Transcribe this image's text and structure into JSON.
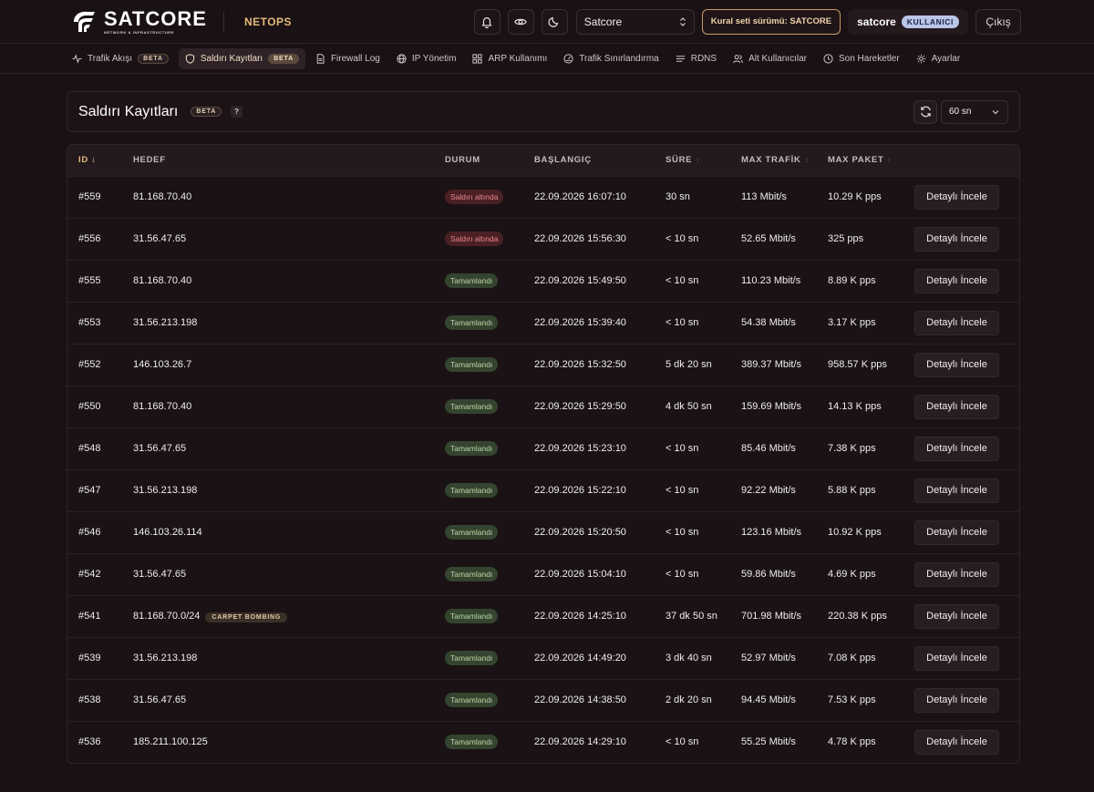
{
  "brand": {
    "name": "SATCORE",
    "tagline": "NETWORK & INFRASTRUCTURE",
    "product": "NETOPS"
  },
  "header": {
    "tenant_select": "Satcore",
    "ruleset": "Kural seti sürümü: SATCORE",
    "user": "satcore",
    "role": "KULLANICI",
    "logout": "Çıkış"
  },
  "nav": [
    {
      "label": "Trafik Akışı",
      "badge": "BETA",
      "icon": "activity-icon",
      "active": false
    },
    {
      "label": "Saldırı Kayıtları",
      "badge": "BETA",
      "icon": "shield-icon",
      "active": true
    },
    {
      "label": "Firewall Log",
      "badge": "",
      "icon": "document-icon",
      "active": false
    },
    {
      "label": "IP Yönetim",
      "badge": "",
      "icon": "globe-icon",
      "active": false
    },
    {
      "label": "ARP Kullanımı",
      "badge": "",
      "icon": "grid-icon",
      "active": false
    },
    {
      "label": "Trafik Sınırlandırma",
      "badge": "",
      "icon": "gauge-icon",
      "active": false
    },
    {
      "label": "RDNS",
      "badge": "",
      "icon": "list-icon",
      "active": false
    },
    {
      "label": "Alt Kullanıcılar",
      "badge": "",
      "icon": "users-icon",
      "active": false
    },
    {
      "label": "Son Hareketler",
      "badge": "",
      "icon": "clock-icon",
      "active": false
    },
    {
      "label": "Ayarlar",
      "badge": "",
      "icon": "gear-icon",
      "active": false
    }
  ],
  "panel": {
    "title": "Saldırı Kayıtları",
    "badge": "BETA",
    "help": "?",
    "interval": "60 sn"
  },
  "table": {
    "headers": {
      "id": "ID",
      "target": "HEDEF",
      "status": "DURUM",
      "start": "BAŞLANGIÇ",
      "duration": "SÜRE",
      "max_traffic": "MAX TRAFİK",
      "max_packet": "MAX PAKET"
    },
    "action_label": "Detaylı İncele",
    "rows": [
      {
        "id": "#559",
        "target": "81.168.70.40",
        "tag": "",
        "status": "Saldırı altında",
        "status_type": "attack",
        "start": "22.09.2026 16:07:10",
        "duration": "30 sn",
        "max_traffic": "113 Mbit/s",
        "max_packet": "10.29 K pps"
      },
      {
        "id": "#556",
        "target": "31.56.47.65",
        "tag": "",
        "status": "Saldırı altında",
        "status_type": "attack",
        "start": "22.09.2026 15:56:30",
        "duration": "< 10 sn",
        "max_traffic": "52.65 Mbit/s",
        "max_packet": "325 pps"
      },
      {
        "id": "#555",
        "target": "81.168.70.40",
        "tag": "",
        "status": "Tamamlandı",
        "status_type": "done",
        "start": "22.09.2026 15:49:50",
        "duration": "< 10 sn",
        "max_traffic": "110.23 Mbit/s",
        "max_packet": "8.89 K pps"
      },
      {
        "id": "#553",
        "target": "31.56.213.198",
        "tag": "",
        "status": "Tamamlandı",
        "status_type": "done",
        "start": "22.09.2026 15:39:40",
        "duration": "< 10 sn",
        "max_traffic": "54.38 Mbit/s",
        "max_packet": "3.17 K pps"
      },
      {
        "id": "#552",
        "target": "146.103.26.7",
        "tag": "",
        "status": "Tamamlandı",
        "status_type": "done",
        "start": "22.09.2026 15:32:50",
        "duration": "5 dk 20 sn",
        "max_traffic": "389.37 Mbit/s",
        "max_packet": "958.57 K pps"
      },
      {
        "id": "#550",
        "target": "81.168.70.40",
        "tag": "",
        "status": "Tamamlandı",
        "status_type": "done",
        "start": "22.09.2026 15:29:50",
        "duration": "4 dk 50 sn",
        "max_traffic": "159.69 Mbit/s",
        "max_packet": "14.13 K pps"
      },
      {
        "id": "#548",
        "target": "31.56.47.65",
        "tag": "",
        "status": "Tamamlandı",
        "status_type": "done",
        "start": "22.09.2026 15:23:10",
        "duration": "< 10 sn",
        "max_traffic": "85.46 Mbit/s",
        "max_packet": "7.38 K pps"
      },
      {
        "id": "#547",
        "target": "31.56.213.198",
        "tag": "",
        "status": "Tamamlandı",
        "status_type": "done",
        "start": "22.09.2026 15:22:10",
        "duration": "< 10 sn",
        "max_traffic": "92.22 Mbit/s",
        "max_packet": "5.88 K pps"
      },
      {
        "id": "#546",
        "target": "146.103.26.114",
        "tag": "",
        "status": "Tamamlandı",
        "status_type": "done",
        "start": "22.09.2026 15:20:50",
        "duration": "< 10 sn",
        "max_traffic": "123.16 Mbit/s",
        "max_packet": "10.92 K pps"
      },
      {
        "id": "#542",
        "target": "31.56.47.65",
        "tag": "",
        "status": "Tamamlandı",
        "status_type": "done",
        "start": "22.09.2026 15:04:10",
        "duration": "< 10 sn",
        "max_traffic": "59.86 Mbit/s",
        "max_packet": "4.69 K pps"
      },
      {
        "id": "#541",
        "target": "81.168.70.0/24",
        "tag": "CARPET BOMBING",
        "status": "Tamamlandı",
        "status_type": "done",
        "start": "22.09.2026 14:25:10",
        "duration": "37 dk 50 sn",
        "max_traffic": "701.98 Mbit/s",
        "max_packet": "220.38 K pps"
      },
      {
        "id": "#539",
        "target": "31.56.213.198",
        "tag": "",
        "status": "Tamamlandı",
        "status_type": "done",
        "start": "22.09.2026 14:49:20",
        "duration": "3 dk 40 sn",
        "max_traffic": "52.97 Mbit/s",
        "max_packet": "7.08 K pps"
      },
      {
        "id": "#538",
        "target": "31.56.47.65",
        "tag": "",
        "status": "Tamamlandı",
        "status_type": "done",
        "start": "22.09.2026 14:38:50",
        "duration": "2 dk 20 sn",
        "max_traffic": "94.45 Mbit/s",
        "max_packet": "7.53 K pps"
      },
      {
        "id": "#536",
        "target": "185.211.100.125",
        "tag": "",
        "status": "Tamamlandı",
        "status_type": "done",
        "start": "22.09.2026 14:29:10",
        "duration": "< 10 sn",
        "max_traffic": "55.25 Mbit/s",
        "max_packet": "4.78 K pps"
      }
    ]
  },
  "colors": {
    "background": "#1a1114",
    "accent": "#e3b97a",
    "attack": "#e98a8f",
    "done": "#b8d6a7"
  }
}
